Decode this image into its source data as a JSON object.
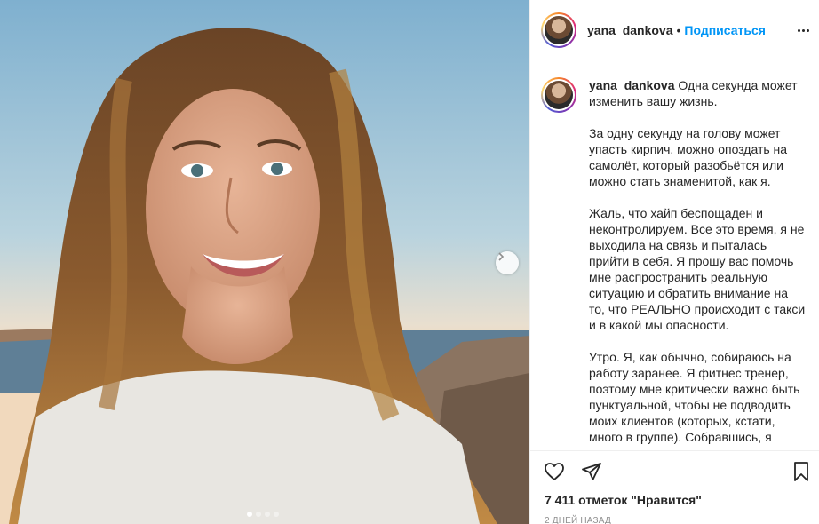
{
  "post": {
    "username": "yana_dankova",
    "separator": "•",
    "follow_label": "Подписаться",
    "caption": "Одна секунда может изменить вашу жизнь.\n\nЗа одну секунду на голову может упасть кирпич, можно опоздать на самолёт, который разобьётся или можно стать знаменитой, как я.\n\nЖаль, что хайп беспощаден и неконтролируем. Все это время, я не выходила на связь и пыталась прийти в себя. Я прошу вас помочь мне распространить реальную ситуацию и обратить внимание на то, что РЕАЛЬНО происходит с такси и в какой мы опасности.\n\nУтро. Я, как обычно, собираюсь на работу заранее. Я фитнес тренер, поэтому мне критически важно быть пунктуальной, чтобы не подводить моих клиентов (которых, кстати, много в группе). Собравшись, я",
    "likes": "7 411 отметок \"Нравится\"",
    "date": "2 дней назад"
  },
  "carousel": {
    "total": 4,
    "current": 1
  },
  "icons": {
    "like": "heart-icon",
    "share": "paper-plane-icon",
    "save": "bookmark-icon",
    "more": "more-options-icon",
    "next": "chevron-right-icon"
  },
  "colors": {
    "accent": "#0095f6",
    "text": "#262626",
    "muted": "#8e8e8e",
    "border": "#efefef"
  }
}
